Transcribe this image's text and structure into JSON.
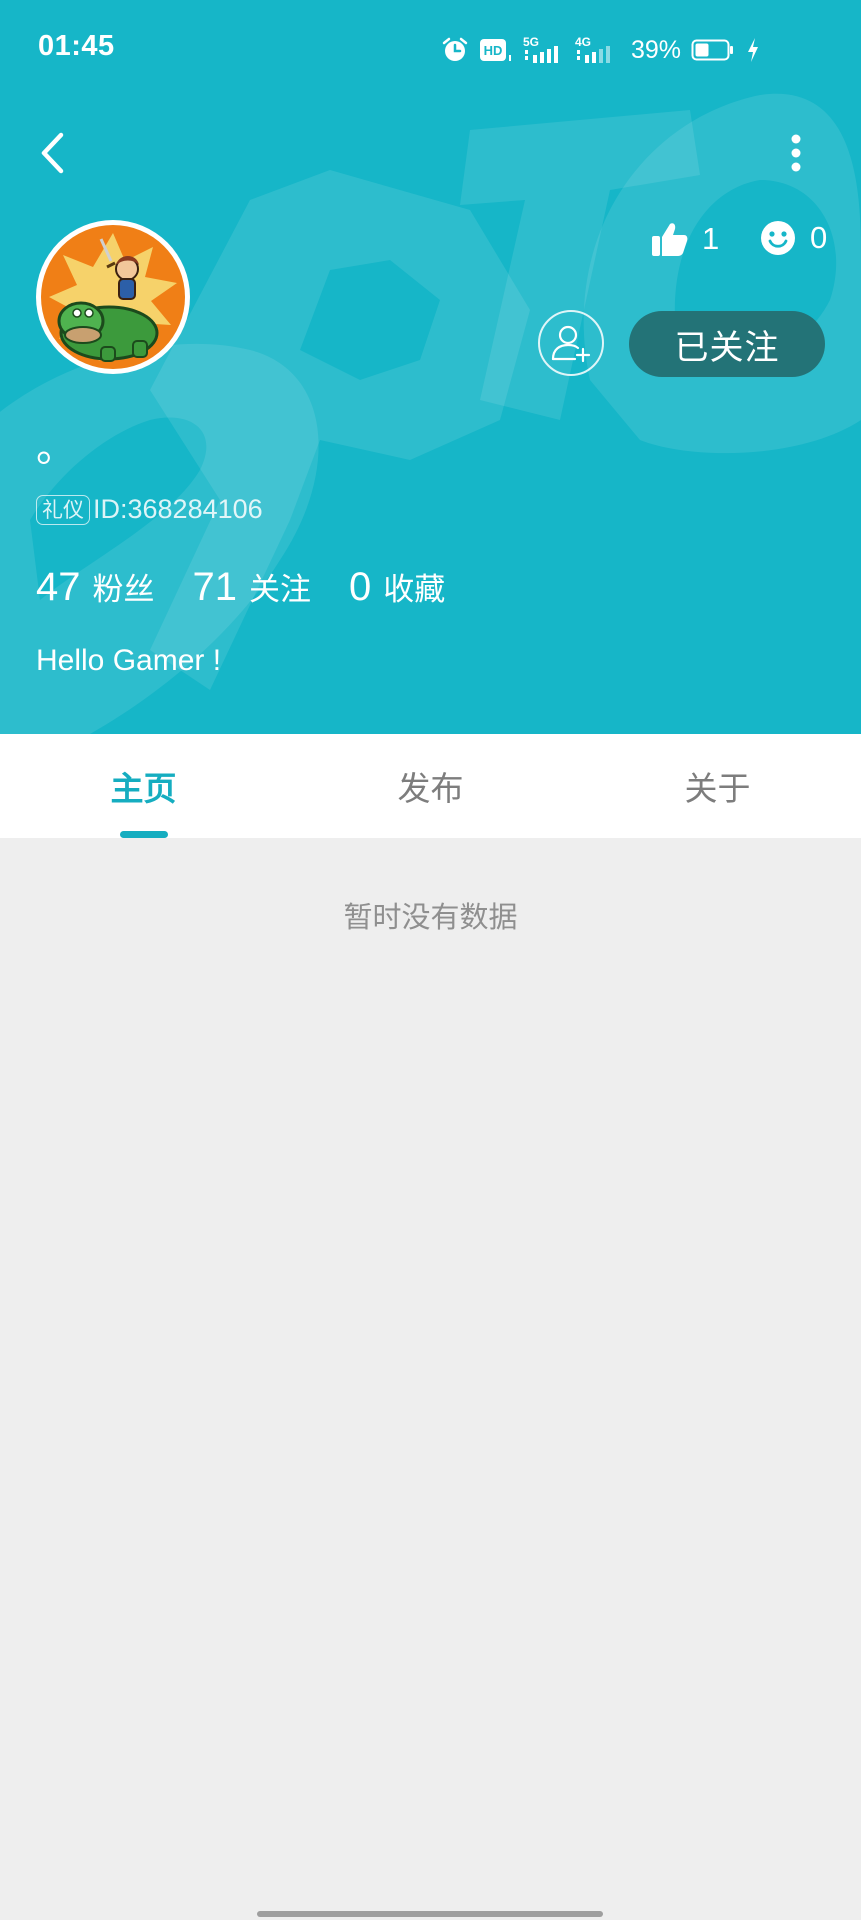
{
  "status_bar": {
    "time": "01:45",
    "hd_label": "HD",
    "net1": "5G",
    "net2": "4G",
    "battery_pct": "39%"
  },
  "profile": {
    "likes": "1",
    "reactions": "0",
    "follow_label": "已关注",
    "nickname": "。",
    "badge": "礼仪",
    "id_text": "ID:368284106",
    "fans_count": "47",
    "fans_label": "粉丝",
    "following_count": "71",
    "following_label": "关注",
    "favorites_count": "0",
    "favorites_label": "收藏",
    "bio": "Hello Gamer !"
  },
  "tabs": [
    {
      "label": "主页",
      "active": true
    },
    {
      "label": "发布",
      "active": false
    },
    {
      "label": "关于",
      "active": false
    }
  ],
  "content": {
    "empty_text": "暂时没有数据"
  },
  "colors": {
    "header_bg": "#16b6c8",
    "accent": "#15adc0",
    "follow_btn": "#237377",
    "page_bg": "#eeeeee"
  }
}
